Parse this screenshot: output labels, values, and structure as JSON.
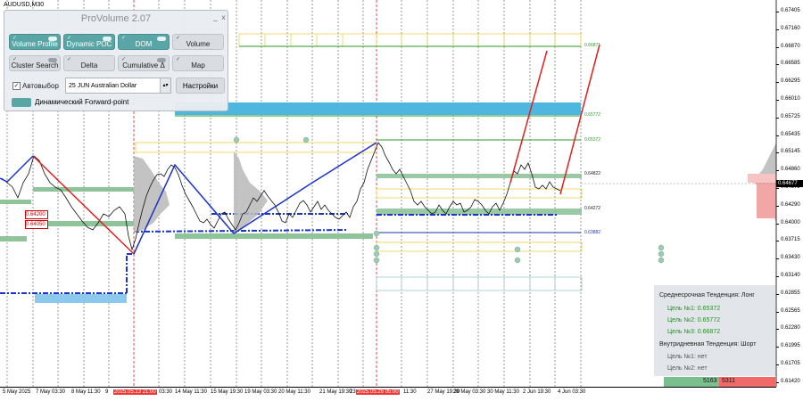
{
  "chart": {
    "symbol": "AUDUSD,M30",
    "current_price": "0.64677",
    "price_ticks": [
      "0.67405",
      "0.67160",
      "0.66870",
      "0.66585",
      "0.66295",
      "0.66010",
      "0.65725",
      "0.65435",
      "0.65145",
      "0.64860",
      "0.64575",
      "0.64290",
      "0.64000",
      "0.63715",
      "0.63430",
      "0.63140",
      "0.62855",
      "0.62565",
      "0.62280",
      "0.61995",
      "0.61705",
      "0.61420"
    ],
    "time_ticks": [
      {
        "label": "5 May 2025",
        "highlight": false
      },
      {
        "label": "7 May 03:30",
        "highlight": false
      },
      {
        "label": "8 May 11:30",
        "highlight": false
      },
      {
        "label": "9",
        "highlight": false
      },
      {
        "label": "2025.05.13 21:00",
        "highlight": true
      },
      {
        "label": "03:30",
        "highlight": false
      },
      {
        "label": "14 May 11:30",
        "highlight": false
      },
      {
        "label": "15 May 19:30",
        "highlight": false
      },
      {
        "label": "19 May 03:30",
        "highlight": false
      },
      {
        "label": "20 May 11:30",
        "highlight": false
      },
      {
        "label": "21 May 19:30",
        "highlight": false
      },
      {
        "label": "23",
        "highlight": false
      },
      {
        "label": "2025.05.26 05:00",
        "highlight": true
      },
      {
        "label": "11:30",
        "highlight": false
      },
      {
        "label": "27 May 19:30",
        "highlight": false
      },
      {
        "label": "29 May 03:30",
        "highlight": false
      },
      {
        "label": "30 May 11:30",
        "highlight": false
      },
      {
        "label": "2 Jun 19:30",
        "highlight": false
      },
      {
        "label": "4 Jun 03:30",
        "highlight": false
      }
    ],
    "levels": [
      {
        "label": "0.66871",
        "color": "g"
      },
      {
        "label": "0.65772",
        "color": "g"
      },
      {
        "label": "0.65372",
        "color": "g"
      },
      {
        "label": "0.64822",
        "color": ""
      },
      {
        "label": "0.64272",
        "color": ""
      },
      {
        "label": "0.63882",
        "color": "b"
      }
    ],
    "left_tags": [
      "0.64200",
      "0.64050"
    ],
    "colors": {
      "support_zone": "#7fb88a",
      "resistance_zone": "#4fb7df",
      "bull_line": "#e02020",
      "bear_line": "#1a33cc",
      "target_line": "#2a9a2a",
      "yellow_box": "#f0d24a"
    }
  },
  "panel": {
    "title": "ProVolume 2.07",
    "window_buttons": [
      "_",
      "x"
    ],
    "buttons": [
      {
        "label": "Volume Profile",
        "active": true
      },
      {
        "label": "Dynamic POC",
        "active": true
      },
      {
        "label": "DOM",
        "active": true
      },
      {
        "label": "Volume",
        "active": false
      },
      {
        "label": "Cluster Search",
        "active": false
      },
      {
        "label": "Delta",
        "active": false
      },
      {
        "label": "Cumulative Δ",
        "active": false
      },
      {
        "label": "Map",
        "active": false
      }
    ],
    "autoselect_label": "Автовыбор",
    "autoselect_checked": true,
    "instrument_value": "25 JUN Australian Dollar",
    "settings_label": "Настройки",
    "forward_label": "Динамический Forward-point"
  },
  "trend_box": {
    "medium_label": "Среднесрочная Тенденция: Лонг",
    "medium_targets": [
      "Цель №1: 0.65372",
      "Цель №2: 0.65772",
      "Цель №3: 0.66872"
    ],
    "intraday_label": "Внутридневная Тенденция: Шорт",
    "intraday_targets": [
      "Цель №1: нет",
      "Цель №2: нет"
    ]
  },
  "volume_bar": {
    "buy": "5163",
    "sell": "5311"
  }
}
